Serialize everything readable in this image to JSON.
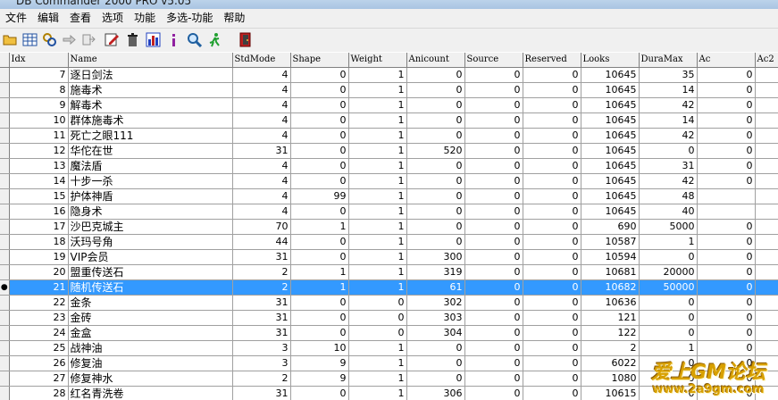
{
  "window": {
    "title": "DB Commander 2000 PRO v5.05"
  },
  "menu": [
    "文件",
    "编辑",
    "查看",
    "选项",
    "功能",
    "多选-功能",
    "帮助"
  ],
  "toolbar": [
    {
      "icon": "folder-open-icon",
      "color": "#d8a000"
    },
    {
      "icon": "table-icon",
      "color": "#2050a0"
    },
    {
      "icon": "query-icon",
      "color": "#b08000"
    },
    {
      "icon": "arrow-right-icon",
      "color": "#909090"
    },
    {
      "icon": "export-icon",
      "color": "#909090"
    },
    {
      "icon": "edit-icon",
      "color": "#c02020"
    },
    {
      "icon": "trash-icon",
      "color": "#404040"
    },
    {
      "icon": "chart-icon",
      "color": "#2040c0"
    },
    {
      "icon": "info-icon",
      "color": "#9020a0"
    },
    {
      "icon": "search-icon",
      "color": "#2060a0"
    },
    {
      "icon": "run-icon",
      "color": "#20a030"
    },
    {
      "icon": "exit-icon",
      "color": "#c02020"
    }
  ],
  "grid": {
    "columns": [
      "Idx",
      "Name",
      "StdMode",
      "Shape",
      "Weight",
      "Anicount",
      "Source",
      "Reserved",
      "Looks",
      "DuraMax",
      "Ac",
      "Ac2"
    ],
    "selected_index": 14,
    "rows": [
      [
        "7",
        "逐日剑法",
        "4",
        "0",
        "1",
        "0",
        "0",
        "0",
        "10645",
        "35",
        "0",
        ""
      ],
      [
        "8",
        "施毒术",
        "4",
        "0",
        "1",
        "0",
        "0",
        "0",
        "10645",
        "14",
        "0",
        ""
      ],
      [
        "9",
        "解毒术",
        "4",
        "0",
        "1",
        "0",
        "0",
        "0",
        "10645",
        "42",
        "0",
        ""
      ],
      [
        "10",
        "群体施毒术",
        "4",
        "0",
        "1",
        "0",
        "0",
        "0",
        "10645",
        "14",
        "0",
        ""
      ],
      [
        "11",
        "死亡之眼111",
        "4",
        "0",
        "1",
        "0",
        "0",
        "0",
        "10645",
        "42",
        "0",
        ""
      ],
      [
        "12",
        "华佗在世",
        "31",
        "0",
        "1",
        "520",
        "0",
        "0",
        "10645",
        "0",
        "0",
        ""
      ],
      [
        "13",
        "魔法盾",
        "4",
        "0",
        "1",
        "0",
        "0",
        "0",
        "10645",
        "31",
        "0",
        ""
      ],
      [
        "14",
        "十步一杀",
        "4",
        "0",
        "1",
        "0",
        "0",
        "0",
        "10645",
        "42",
        "0",
        ""
      ],
      [
        "15",
        "护体神盾",
        "4",
        "99",
        "1",
        "0",
        "0",
        "0",
        "10645",
        "48",
        "",
        ""
      ],
      [
        "16",
        "隐身术",
        "4",
        "0",
        "1",
        "0",
        "0",
        "0",
        "10645",
        "40",
        "",
        ""
      ],
      [
        "17",
        "沙巴克城主",
        "70",
        "1",
        "1",
        "0",
        "0",
        "0",
        "690",
        "5000",
        "0",
        ""
      ],
      [
        "18",
        "沃玛号角",
        "44",
        "0",
        "1",
        "0",
        "0",
        "0",
        "10587",
        "1",
        "0",
        ""
      ],
      [
        "19",
        "VIP会员",
        "31",
        "0",
        "1",
        "300",
        "0",
        "0",
        "10594",
        "0",
        "0",
        ""
      ],
      [
        "20",
        "盟重传送石",
        "2",
        "1",
        "1",
        "319",
        "0",
        "0",
        "10681",
        "20000",
        "0",
        ""
      ],
      [
        "21",
        "随机传送石",
        "2",
        "1",
        "1",
        "61",
        "0",
        "0",
        "10682",
        "50000",
        "0",
        ""
      ],
      [
        "22",
        "金条",
        "31",
        "0",
        "0",
        "302",
        "0",
        "0",
        "10636",
        "0",
        "0",
        ""
      ],
      [
        "23",
        "金砖",
        "31",
        "0",
        "0",
        "303",
        "0",
        "0",
        "121",
        "0",
        "0",
        ""
      ],
      [
        "24",
        "金盒",
        "31",
        "0",
        "0",
        "304",
        "0",
        "0",
        "122",
        "0",
        "0",
        ""
      ],
      [
        "25",
        "战神油",
        "3",
        "10",
        "1",
        "0",
        "0",
        "0",
        "2",
        "1",
        "0",
        ""
      ],
      [
        "26",
        "修复油",
        "3",
        "9",
        "1",
        "0",
        "0",
        "0",
        "6022",
        "0",
        "0",
        ""
      ],
      [
        "27",
        "修复神水",
        "2",
        "9",
        "1",
        "0",
        "0",
        "0",
        "1080",
        "0",
        "0",
        ""
      ],
      [
        "28",
        "红名青洗卷",
        "31",
        "0",
        "1",
        "306",
        "0",
        "0",
        "10615",
        "0",
        "0",
        ""
      ]
    ]
  },
  "watermark": {
    "line1": "爱上GM论坛",
    "line2": "www.2a9gm.com"
  },
  "colors": {
    "selection": "#3399ff",
    "header": "#f0f0f0",
    "grid_line": "#a0a0a0"
  }
}
